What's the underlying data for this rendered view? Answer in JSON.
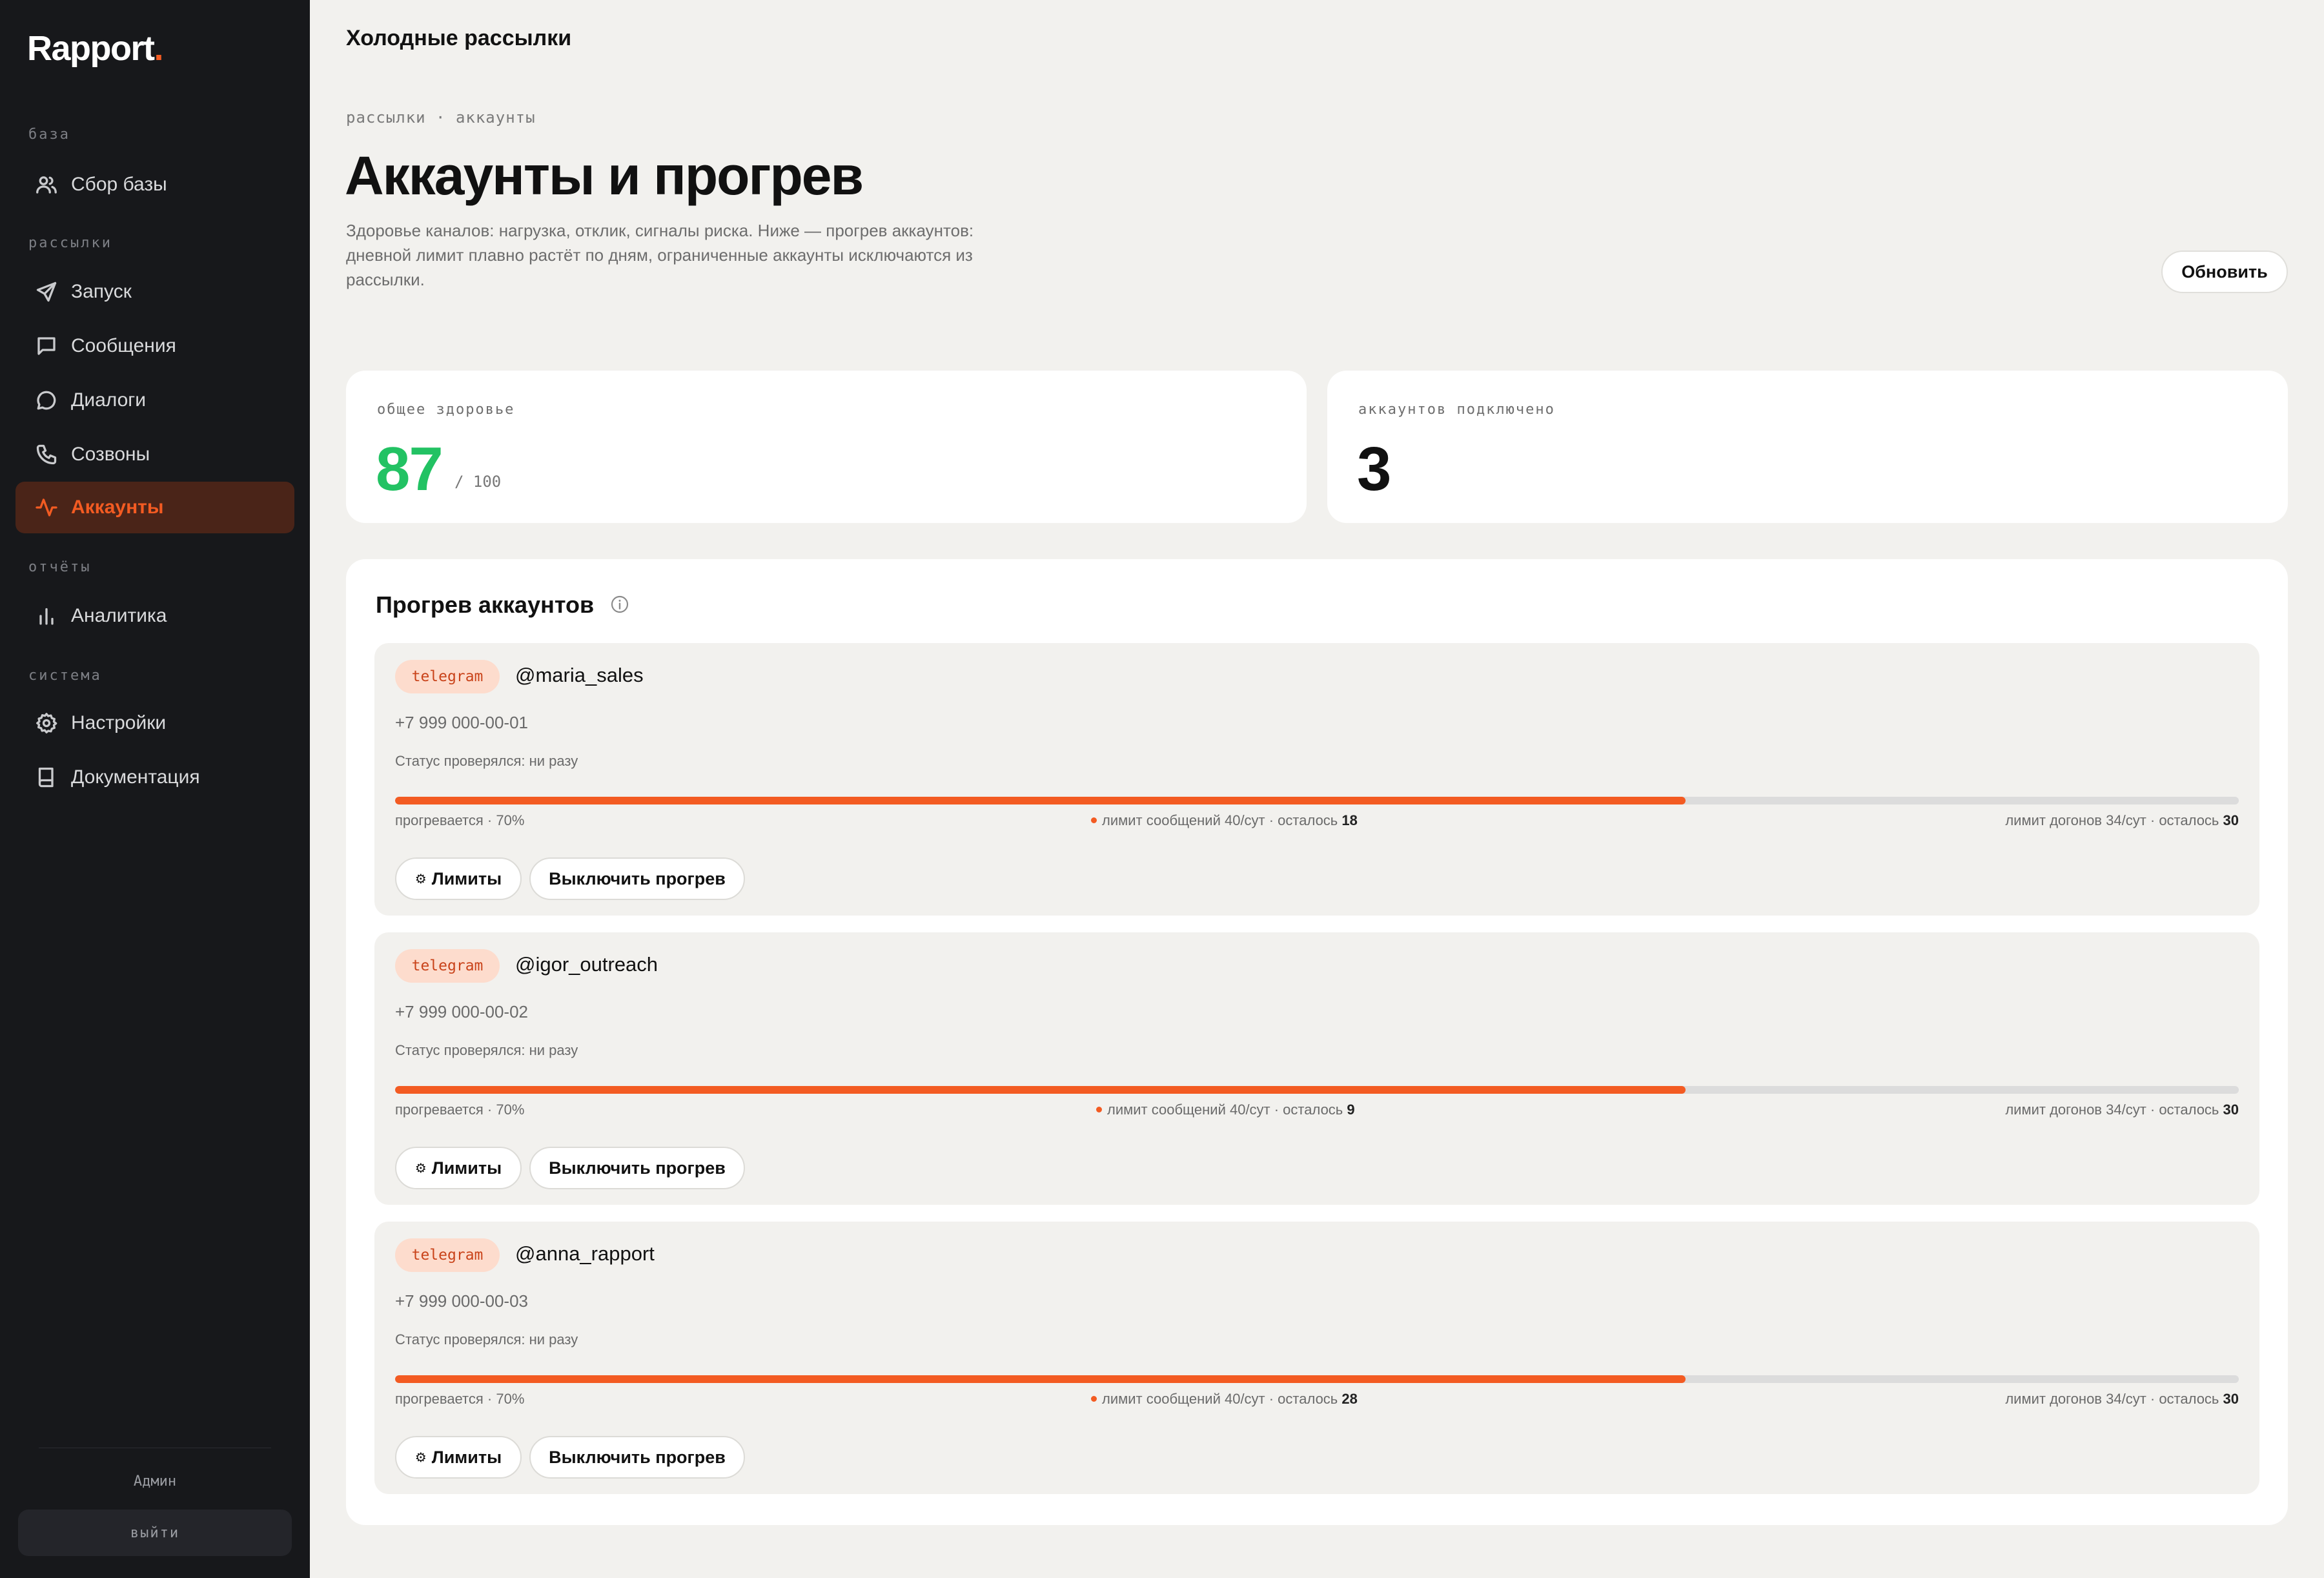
{
  "app": {
    "logo_text": "Rapport",
    "logo_dot": ".",
    "accent_color": "#f35b22",
    "health_color": "#22c263"
  },
  "sidebar": {
    "sections": [
      {
        "label": "база",
        "items": [
          {
            "label": "Сбор базы",
            "icon": "users-icon"
          }
        ]
      },
      {
        "label": "рассылки",
        "items": [
          {
            "label": "Запуск",
            "icon": "send-icon"
          },
          {
            "label": "Сообщения",
            "icon": "message-square-icon"
          },
          {
            "label": "Диалоги",
            "icon": "chat-bubble-icon"
          },
          {
            "label": "Созвоны",
            "icon": "phone-icon"
          },
          {
            "label": "Аккаунты",
            "icon": "activity-icon",
            "active": true
          }
        ]
      },
      {
        "label": "отчёты",
        "items": [
          {
            "label": "Аналитика",
            "icon": "bar-chart-icon"
          }
        ]
      },
      {
        "label": "система",
        "items": [
          {
            "label": "Настройки",
            "icon": "gear-icon"
          },
          {
            "label": "Документация",
            "icon": "book-icon"
          }
        ]
      }
    ],
    "user_label": "Админ",
    "logout_label": "выйти"
  },
  "header": {
    "title": "Холодные рассылки",
    "breadcrumb": "рассылки · аккаунты",
    "page_title": "Аккаунты и прогрев",
    "description": "Здоровье каналов: нагрузка, отклик, сигналы риска. Ниже — прогрев аккаунтов: дневной лимит плавно растёт по дням, ограниченные аккаунты исключаются из рассылки.",
    "refresh_label": "Обновить"
  },
  "stats": {
    "health": {
      "label": "общее здоровье",
      "value": "87",
      "suffix": "/ 100"
    },
    "accounts": {
      "label": "аккаунтов подключено",
      "value": "3"
    }
  },
  "warmup": {
    "title": "Прогрев аккаунтов",
    "limits_button": "Лимиты",
    "disable_button": "Выключить прогрев",
    "accounts": [
      {
        "channel": "telegram",
        "username": "@maria_sales",
        "phone": "+7 999 000-00-01",
        "status": "Статус проверялся: ни разу",
        "progress": 0.7,
        "progress_label": "прогревается · 70%",
        "msg_limit_label": "лимит сообщений 40/сут · осталось ",
        "msg_left": "18",
        "followup_limit_label": "лимит догонов 34/сут · осталось ",
        "followup_left": "30"
      },
      {
        "channel": "telegram",
        "username": "@igor_outreach",
        "phone": "+7 999 000-00-02",
        "status": "Статус проверялся: ни разу",
        "progress": 0.7,
        "progress_label": "прогревается · 70%",
        "msg_limit_label": "лимит сообщений 40/сут · осталось ",
        "msg_left": "9",
        "followup_limit_label": "лимит догонов 34/сут · осталось ",
        "followup_left": "30"
      },
      {
        "channel": "telegram",
        "username": "@anna_rapport",
        "phone": "+7 999 000-00-03",
        "status": "Статус проверялся: ни разу",
        "progress": 0.7,
        "progress_label": "прогревается · 70%",
        "msg_limit_label": "лимит сообщений 40/сут · осталось ",
        "msg_left": "28",
        "followup_limit_label": "лимит догонов 34/сут · осталось ",
        "followup_left": "30"
      }
    ]
  }
}
